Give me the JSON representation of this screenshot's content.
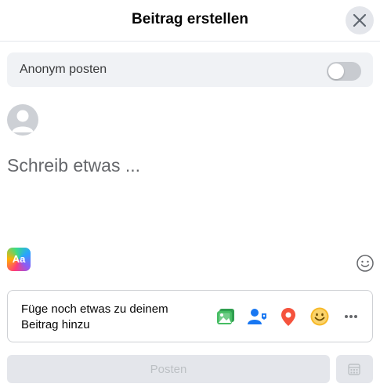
{
  "header": {
    "title": "Beitrag erstellen",
    "close_icon": "close-icon"
  },
  "anonymous": {
    "label": "Anonym posten",
    "enabled": false
  },
  "composer": {
    "placeholder": "Schreib etwas ..."
  },
  "background_picker": {
    "label": "Aa"
  },
  "add_to_post": {
    "label": "Füge noch etwas zu deinem Beitrag hinzu",
    "icons": [
      "photo-video-icon",
      "tag-people-icon",
      "location-icon",
      "feeling-icon",
      "more-icon"
    ]
  },
  "footer": {
    "post_label": "Posten",
    "schedule_icon": "calendar-icon"
  },
  "colors": {
    "photo": "#45bd62",
    "tag": "#1877f2",
    "location": "#f5533d",
    "feeling": "#f7b928",
    "muted": "#65676b"
  }
}
